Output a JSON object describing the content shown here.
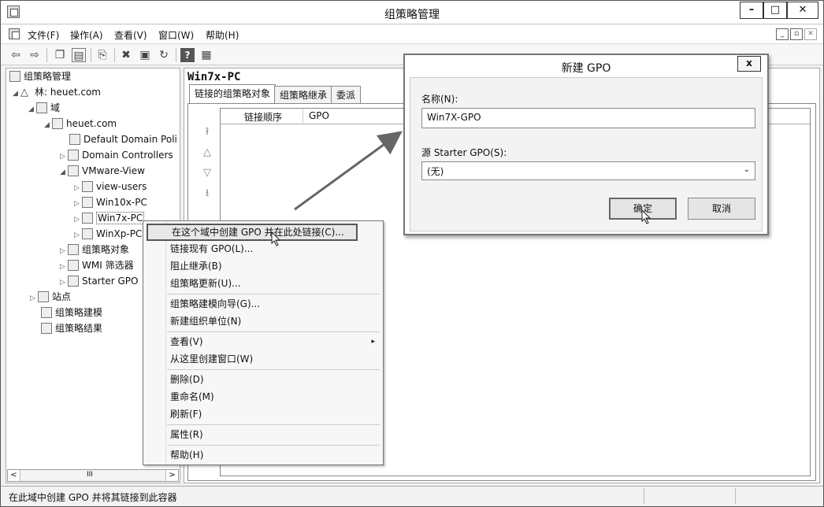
{
  "window": {
    "title": "组策略管理",
    "controls": {
      "minimize": "–",
      "maximize": "□",
      "close": "✕"
    }
  },
  "menubar": {
    "items": [
      "文件(F)",
      "操作(A)",
      "查看(V)",
      "窗口(W)",
      "帮助(H)"
    ],
    "mdi": {
      "minimize": "_",
      "restore": "▫",
      "close": "✕"
    }
  },
  "toolbar": {
    "icons": [
      "back-icon",
      "forward-icon",
      "up-folder-icon",
      "show-hide-tree-icon",
      "copy-icon",
      "delete-icon",
      "properties-icon",
      "refresh-icon",
      "help-icon",
      "console-tree-icon"
    ]
  },
  "tree": {
    "root": "组策略管理",
    "forest": "林: heuet.com",
    "domains": "域",
    "domain": "heuet.com",
    "items": {
      "default_policy": "Default Domain Poli",
      "domain_controllers": "Domain Controllers",
      "vmware_view": "VMware-View",
      "view_users": "view-users",
      "win10x": "Win10x-PC",
      "win7x": "Win7x-PC",
      "winxp": "WinXp-PC",
      "gpo_objects": "组策略对象",
      "wmi_filters": "WMI 筛选器",
      "starter_gpo": "Starter GPO"
    },
    "sites": "站点",
    "modeling": "组策略建模",
    "results": "组策略结果",
    "scroll_mark": "III"
  },
  "right_pane": {
    "title": "Win7x-PC",
    "tabs": [
      "链接的组策略对象",
      "组策略继承",
      "委派"
    ],
    "columns": [
      "链接顺序",
      "GPO"
    ]
  },
  "context_menu": {
    "items": [
      "在这个域中创建 GPO 并在此处链接(C)...",
      "链接现有 GPO(L)...",
      "阻止继承(B)",
      "组策略更新(U)...",
      "组策略建模向导(G)...",
      "新建组织单位(N)",
      "查看(V)",
      "从这里创建窗口(W)",
      "删除(D)",
      "重命名(M)",
      "刷新(F)",
      "属性(R)",
      "帮助(H)"
    ],
    "submenu_arrow": "▸"
  },
  "dialog": {
    "title": "新建 GPO",
    "close": "x",
    "name_label": "名称(N):",
    "name_value": "Win7X-GPO",
    "starter_label": "源 Starter GPO(S):",
    "starter_value": "(无)",
    "ok": "确定",
    "cancel": "取消"
  },
  "statusbar": {
    "text": "在此域中创建 GPO 并将其链接到此容器"
  }
}
